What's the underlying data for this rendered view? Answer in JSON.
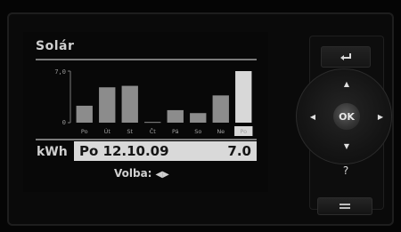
{
  "screen": {
    "title": "Solár",
    "unit": "kWh",
    "selected_date": "Po 12.10.09",
    "selected_value": "7.0",
    "hint_label": "Volba:",
    "hint_arrows": "◀▶"
  },
  "chart_data": {
    "type": "bar",
    "categories": [
      "Po",
      "Út",
      "St",
      "Čt",
      "Pá",
      "So",
      "Ne",
      "Po"
    ],
    "values": [
      2.3,
      4.8,
      5.0,
      0.1,
      1.7,
      1.3,
      3.7,
      7.0
    ],
    "selected_index": 7,
    "ylim": [
      0,
      7.0
    ],
    "ytick_labels": [
      "7,0",
      "0"
    ],
    "colors": {
      "bar": "#8c8c8c",
      "selected": "#d8d8d8",
      "axis": "#7a7a7a"
    }
  },
  "keypad": {
    "back_icon": "return-arrow-icon",
    "up": "▲",
    "down": "▼",
    "left": "◀",
    "right": "▶",
    "ok": "OK",
    "help": "?",
    "menu_icon": "menu-bars-icon"
  }
}
